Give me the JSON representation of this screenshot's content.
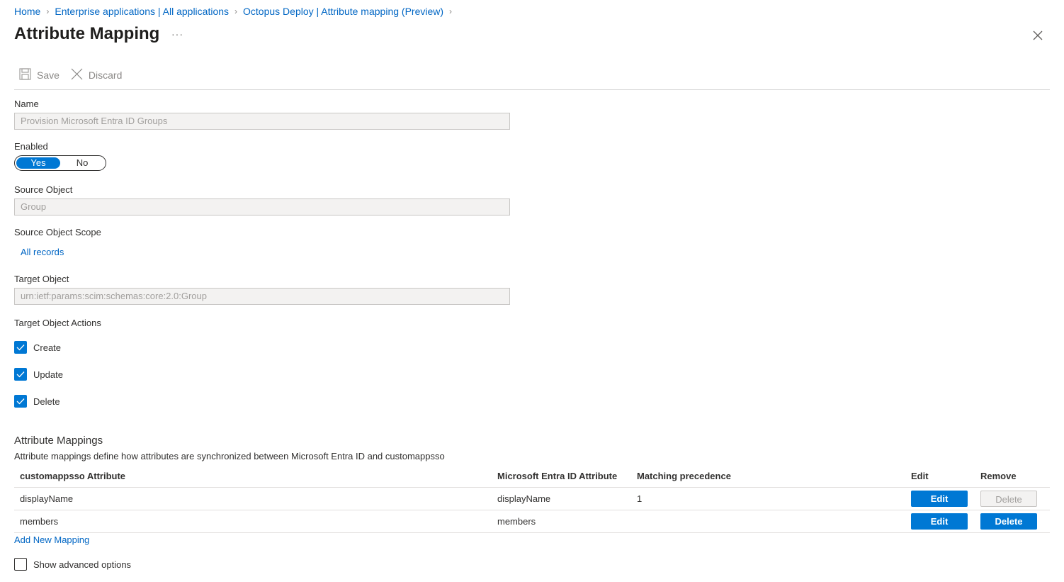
{
  "breadcrumb": [
    "Home",
    "Enterprise applications | All applications",
    "Octopus Deploy | Attribute mapping (Preview)"
  ],
  "page_title": "Attribute Mapping",
  "more_label": "···",
  "toolbar": {
    "save_label": "Save",
    "discard_label": "Discard"
  },
  "form": {
    "name_label": "Name",
    "name_value": "Provision Microsoft Entra ID Groups",
    "enabled_label": "Enabled",
    "enabled_yes": "Yes",
    "enabled_no": "No",
    "enabled_selected": "Yes",
    "source_object_label": "Source Object",
    "source_object_value": "Group",
    "source_scope_label": "Source Object Scope",
    "source_scope_link": "All records",
    "target_object_label": "Target Object",
    "target_object_value": "urn:ietf:params:scim:schemas:core:2.0:Group",
    "target_actions_label": "Target Object Actions",
    "actions": [
      {
        "label": "Create",
        "checked": true
      },
      {
        "label": "Update",
        "checked": true
      },
      {
        "label": "Delete",
        "checked": true
      }
    ]
  },
  "mappings": {
    "title": "Attribute Mappings",
    "description": "Attribute mappings define how attributes are synchronized between Microsoft Entra ID and customappsso",
    "columns": [
      "customappsso Attribute",
      "Microsoft Entra ID Attribute",
      "Matching precedence",
      "Edit",
      "Remove"
    ],
    "rows": [
      {
        "target": "displayName",
        "source": "displayName",
        "precedence": "1",
        "edit": "Edit",
        "remove": "Delete",
        "remove_disabled": true
      },
      {
        "target": "members",
        "source": "members",
        "precedence": "",
        "edit": "Edit",
        "remove": "Delete",
        "remove_disabled": false
      }
    ],
    "add_link": "Add New Mapping"
  },
  "advanced": {
    "label": "Show advanced options",
    "checked": false
  },
  "colors": {
    "accent": "#0078d4",
    "link": "#0066c4"
  },
  "icons": {
    "save": "save-icon",
    "discard": "discard-icon",
    "close": "close-icon",
    "checkmark": "checkmark-icon"
  }
}
